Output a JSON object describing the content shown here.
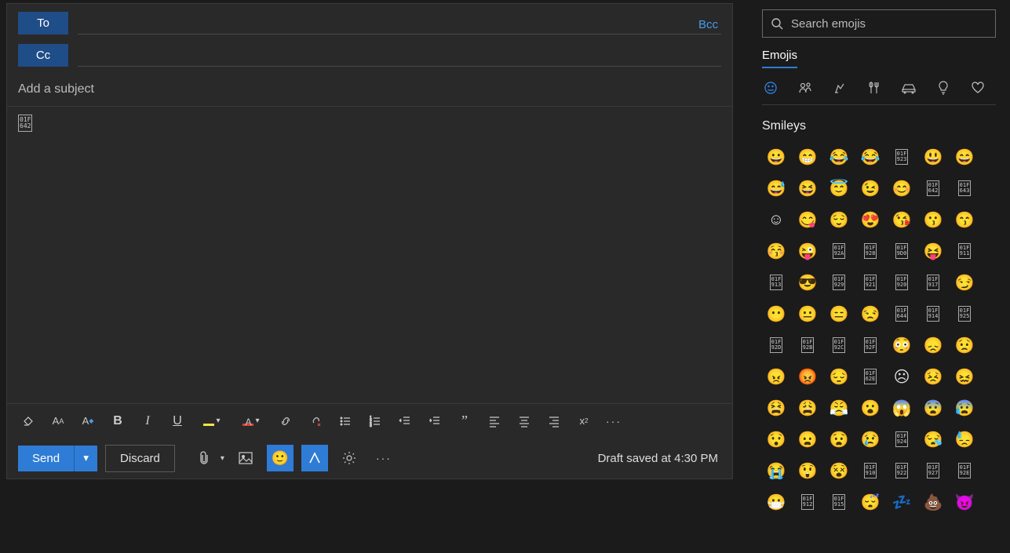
{
  "compose": {
    "to_label": "To",
    "cc_label": "Cc",
    "bcc_label": "Bcc",
    "subject_placeholder": "Add a subject",
    "body_glyph": "01F\n642",
    "send_label": "Send",
    "discard_label": "Discard",
    "draft_status": "Draft saved at 4:30 PM"
  },
  "emoji_panel": {
    "search_placeholder": "Search emojis",
    "tab_label": "Emojis",
    "section_title": "Smileys",
    "categories": [
      {
        "name": "smileys",
        "icon": "☺",
        "active": true
      },
      {
        "name": "people",
        "icon": "👥",
        "active": false
      },
      {
        "name": "animals",
        "icon": "🐿",
        "active": false
      },
      {
        "name": "food",
        "icon": "🍴",
        "active": false
      },
      {
        "name": "travel",
        "icon": "🚗",
        "active": false
      },
      {
        "name": "objects",
        "icon": "💡",
        "active": false
      },
      {
        "name": "symbols",
        "icon": "♡",
        "active": false
      }
    ],
    "grid": [
      [
        "😀",
        "😁",
        "😂",
        "😂",
        "01F\n923",
        "😃",
        "😄"
      ],
      [
        "😅",
        "😆",
        "😇",
        "😉",
        "😊",
        "01F\n642",
        "01F\n643"
      ],
      [
        "☺",
        "😋",
        "😌",
        "😍",
        "😘",
        "😗",
        "😙"
      ],
      [
        "😚",
        "😜",
        "01F\n92A",
        "01F\n928",
        "01F\n9D0",
        "😝",
        "01F\n911"
      ],
      [
        "01F\n913",
        "😎",
        "01F\n929",
        "01F\n921",
        "01F\n920",
        "01F\n917",
        "😏"
      ],
      [
        "😶",
        "😐",
        "😑",
        "😒",
        "01F\n644",
        "01F\n914",
        "01F\n925"
      ],
      [
        "01F\n92D",
        "01F\n92B",
        "01F\n92C",
        "01F\n92F",
        "😳",
        "😞",
        "😟"
      ],
      [
        "😠",
        "😡",
        "😔",
        "01F\n62E",
        "☹",
        "😣",
        "😖"
      ],
      [
        "😫",
        "😩",
        "😤",
        "😮",
        "😱",
        "😨",
        "😰"
      ],
      [
        "😯",
        "😦",
        "😧",
        "😢",
        "01F\n924",
        "😪",
        "😓"
      ],
      [
        "😭",
        "😲",
        "😵",
        "01F\n910",
        "01F\n922",
        "01F\n927",
        "01F\n92E"
      ],
      [
        "😷",
        "01F\n912",
        "01F\n915",
        "😴",
        "💤",
        "💩",
        "😈"
      ]
    ]
  }
}
